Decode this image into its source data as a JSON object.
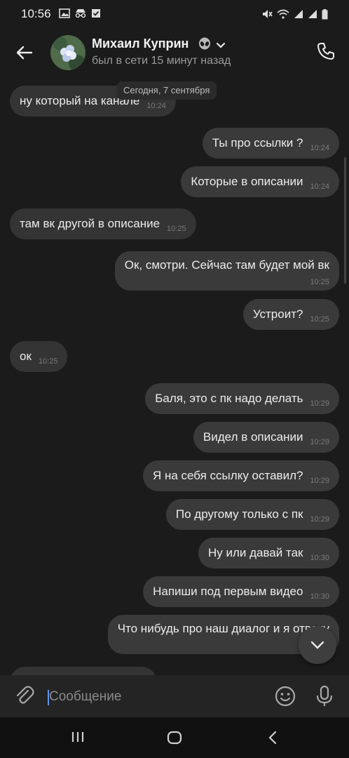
{
  "status_bar": {
    "time": "10:56",
    "left_icons": [
      "gallery-icon",
      "incognito-icon",
      "check-box-icon"
    ],
    "right_icons": [
      "mute-icon",
      "wifi-icon",
      "signal-icon",
      "signal-icon-2",
      "battery-icon"
    ]
  },
  "header": {
    "name": "Михаил Куприн",
    "status": "был в сети 15 минут назад"
  },
  "chat": {
    "date_divider": "Сегодня, 7 сентября",
    "messages": [
      {
        "dir": "in",
        "text": "ну который на канале",
        "time": "10:24"
      },
      {
        "dir": "out",
        "text": "Ты про ссылки ?",
        "time": "10:24"
      },
      {
        "dir": "out",
        "text": "Которые в описании",
        "time": "10:24"
      },
      {
        "dir": "in",
        "text": "там вк другой в описание",
        "time": "10:25"
      },
      {
        "dir": "out",
        "text": "Ок, смотри. Сейчас там будет мой вк",
        "time": "10:25"
      },
      {
        "dir": "out",
        "text": "Устроит?",
        "time": "10:25"
      },
      {
        "dir": "in",
        "text": "ок",
        "time": "10:25"
      },
      {
        "dir": "out",
        "text": "Баля, это с пк надо делать",
        "time": "10:29"
      },
      {
        "dir": "out",
        "text": "Видел в описании",
        "time": "10:29"
      },
      {
        "dir": "out",
        "text": "Я на себя ссылку оставил?",
        "time": "10:29"
      },
      {
        "dir": "out",
        "text": "По другому только с пк",
        "time": "10:29"
      },
      {
        "dir": "out",
        "text": "Ну или давай так",
        "time": "10:30"
      },
      {
        "dir": "out",
        "text": "Напиши под первым видео",
        "time": "10:30"
      },
      {
        "dir": "out",
        "text": "Что нибудь про наш диалог и я отвечу",
        "time": ""
      }
    ]
  },
  "composer": {
    "placeholder": "Сообщение"
  },
  "colors": {
    "background": "#1b1b1b",
    "bubble": "#343434",
    "accent": "#5f94e8"
  }
}
